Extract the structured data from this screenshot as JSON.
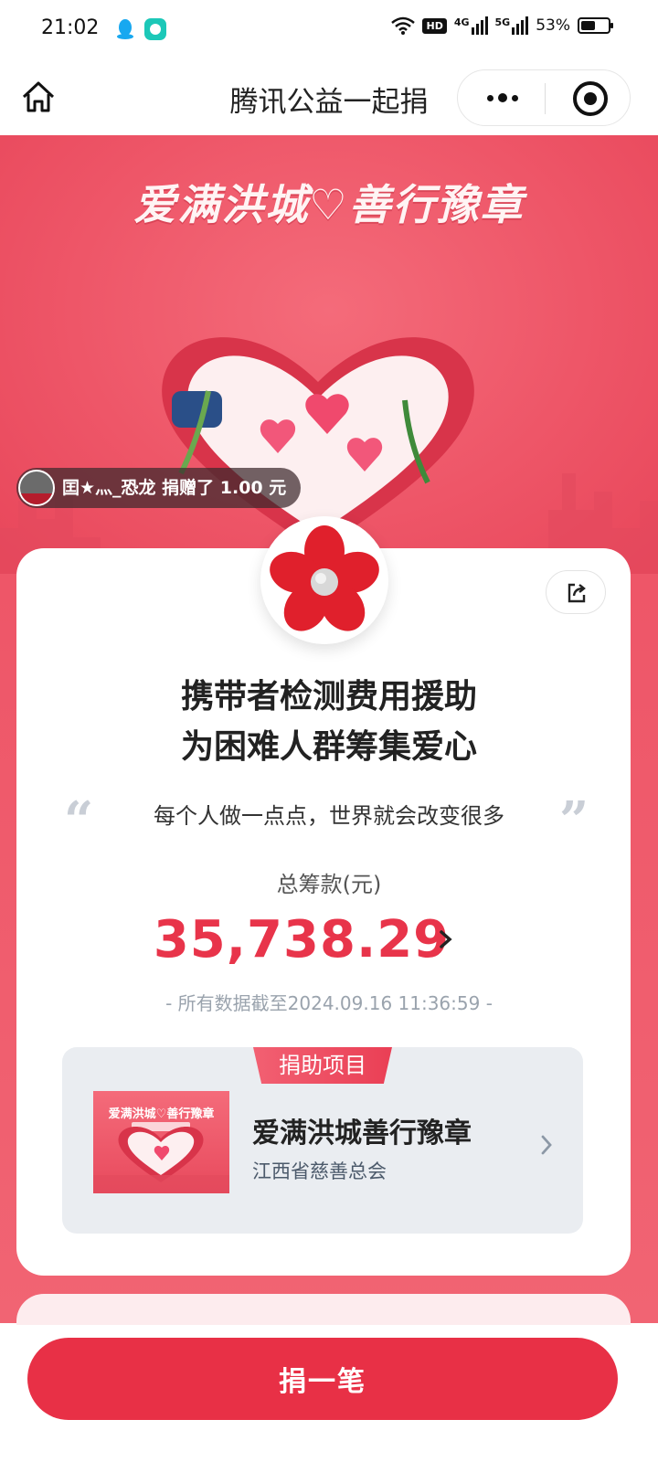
{
  "status_bar": {
    "time": "21:02",
    "network_badge": "HD",
    "signal_1": "4G",
    "signal_2": "5G",
    "battery_text": "53%",
    "battery_level": 0.53
  },
  "navbar": {
    "title": "腾讯公益一起捐",
    "home_icon": "home-icon",
    "more_icon": "more-dots-icon",
    "close_icon": "target-close-icon"
  },
  "banner": {
    "title": "爱满洪城♡善行豫章"
  },
  "donor_toast": {
    "text": "囯★灬_恐龙 捐赠了 1.00 元"
  },
  "project": {
    "title_line1": "携带者检测费用援助",
    "title_line2": "为困难人群筹集爱心",
    "slogan": "每个人做一点点，世界就会改变很多",
    "quote_open": "“",
    "quote_close": "”",
    "total_label": "总筹款(元)",
    "total_amount": "35,738.29",
    "timestamp": "- 所有数据截至2024.09.16 11:36:59 -"
  },
  "linked_project": {
    "tag": "捐助项目",
    "thumb_title": "爱满洪城♡善行豫章",
    "name": "爱满洪城善行豫章",
    "org": "江西省慈善总会"
  },
  "bottom": {
    "donate_label": "捐一笔"
  },
  "colors": {
    "accent": "#e83046",
    "amount": "#e8344a",
    "banner": "#ee5668"
  }
}
